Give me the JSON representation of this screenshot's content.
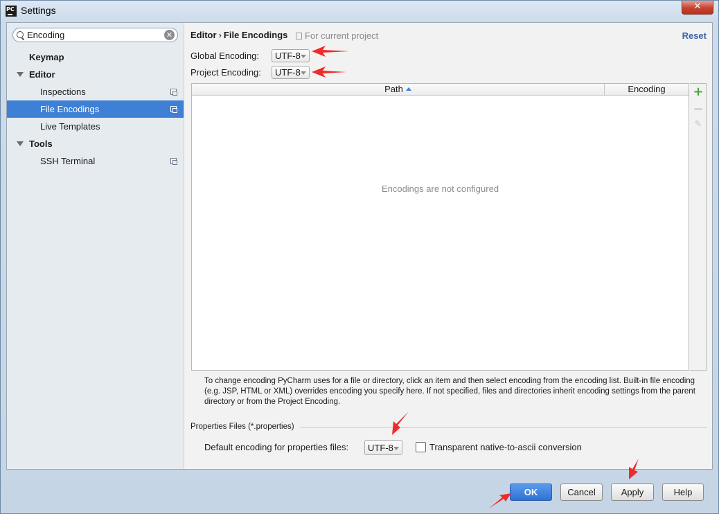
{
  "window": {
    "title": "Settings",
    "app_icon_text": "PC"
  },
  "search": {
    "value": "Encoding"
  },
  "sidebar": {
    "items": [
      {
        "label": "Keymap"
      },
      {
        "label": "Editor"
      },
      {
        "label": "Inspections"
      },
      {
        "label": "File Encodings"
      },
      {
        "label": "Live Templates"
      },
      {
        "label": "Tools"
      },
      {
        "label": "SSH Terminal"
      }
    ]
  },
  "header": {
    "crumb1": "Editor",
    "separator": "›",
    "crumb2": "File Encodings",
    "note": "For current project",
    "reset": "Reset"
  },
  "global_encoding": {
    "label": "Global Encoding:",
    "value": "UTF-8"
  },
  "project_encoding": {
    "label": "Project Encoding:",
    "value": "UTF-8"
  },
  "table": {
    "columns": [
      "Path",
      "Encoding"
    ],
    "sorted_column": "Path",
    "empty_text": "Encodings are not configured"
  },
  "help_text": "To change encoding PyCharm uses for a file or directory, click an item and then select encoding from the encoding list. Built-in file encoding (e.g. JSP, HTML or XML) overrides encoding you specify here. If not specified, files and directories inherit encoding settings from the parent directory or from the Project Encoding.",
  "properties": {
    "group_title": "Properties Files (*.properties)",
    "default_label": "Default encoding for properties files:",
    "default_value": "UTF-8",
    "transparent_label": "Transparent native-to-ascii conversion",
    "transparent_checked": false
  },
  "buttons": {
    "ok": "OK",
    "cancel": "Cancel",
    "apply": "Apply",
    "help": "Help"
  },
  "icons": {
    "close": "close-icon",
    "search": "search-icon",
    "clear": "clear-icon",
    "add": "add-icon",
    "remove": "remove-icon",
    "edit": "edit-icon",
    "copy": "project-settings-icon",
    "annotation": "red-arrow"
  },
  "colors": {
    "selection": "#3d80d6",
    "accent": "#3a63a8",
    "annotation": "#ee2b2b",
    "add": "#4aa33c"
  }
}
